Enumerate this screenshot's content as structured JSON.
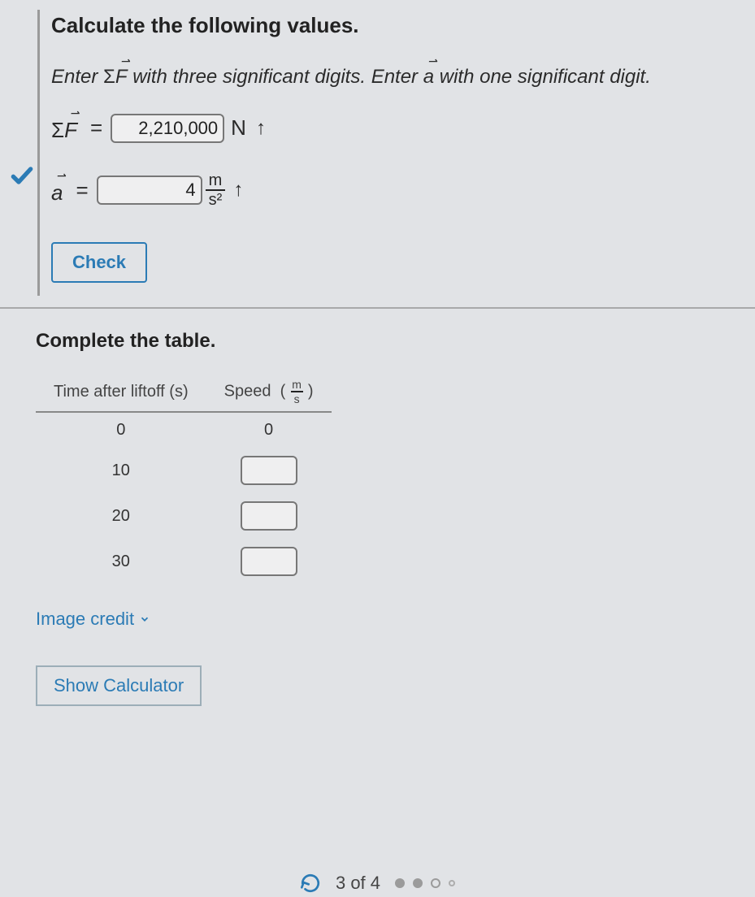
{
  "section1": {
    "heading": "Calculate the following values.",
    "instruction_pre": "Enter ",
    "instruction_mid": " with three significant digits. Enter ",
    "instruction_post": " with one significant digit.",
    "sigmaF_label": "ΣF",
    "a_label": "a",
    "F_value": "2,210,000",
    "F_unit": "N",
    "a_value": "4",
    "a_unit_num": "m",
    "a_unit_den": "s²",
    "arrow": "↑",
    "check_label": "Check"
  },
  "section2": {
    "heading": "Complete the table.",
    "col1_label": "Time after liftoff",
    "col1_unit": "(s)",
    "col2_label": "Speed",
    "col2_unit_num": "m",
    "col2_unit_den": "s",
    "rows": [
      {
        "t": "0",
        "v": "0"
      },
      {
        "t": "10",
        "v": ""
      },
      {
        "t": "20",
        "v": ""
      },
      {
        "t": "30",
        "v": ""
      }
    ],
    "credit": "Image credit",
    "show_calc": "Show Calculator"
  },
  "footer": {
    "pager": "3 of 4"
  }
}
